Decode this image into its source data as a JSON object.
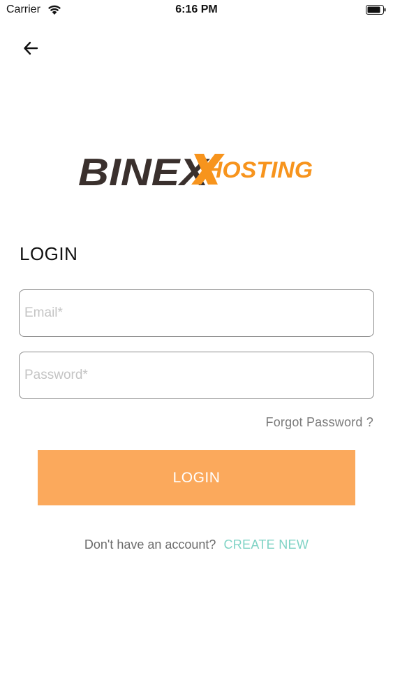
{
  "status_bar": {
    "carrier": "Carrier",
    "time": "6:16 PM"
  },
  "icons": {
    "back": "arrow-left-icon",
    "wifi": "wifi-icon",
    "battery": "battery-icon"
  },
  "logo": {
    "brand_main": "BINEX",
    "brand_sub": "HOSTING",
    "colors": {
      "dark": "#3a302d",
      "accent": "#f7941d"
    }
  },
  "login": {
    "heading": "LOGIN",
    "email_placeholder": "Email*",
    "email_value": "",
    "password_placeholder": "Password*",
    "password_value": "",
    "forgot_label": "Forgot Password ?",
    "submit_label": "LOGIN"
  },
  "signup": {
    "prompt": "Don't have an account?",
    "link_label": "CREATE NEW"
  },
  "colors": {
    "button_bg": "#fba95c",
    "link": "#7fd3c5",
    "muted_text": "#7a7a7a"
  }
}
